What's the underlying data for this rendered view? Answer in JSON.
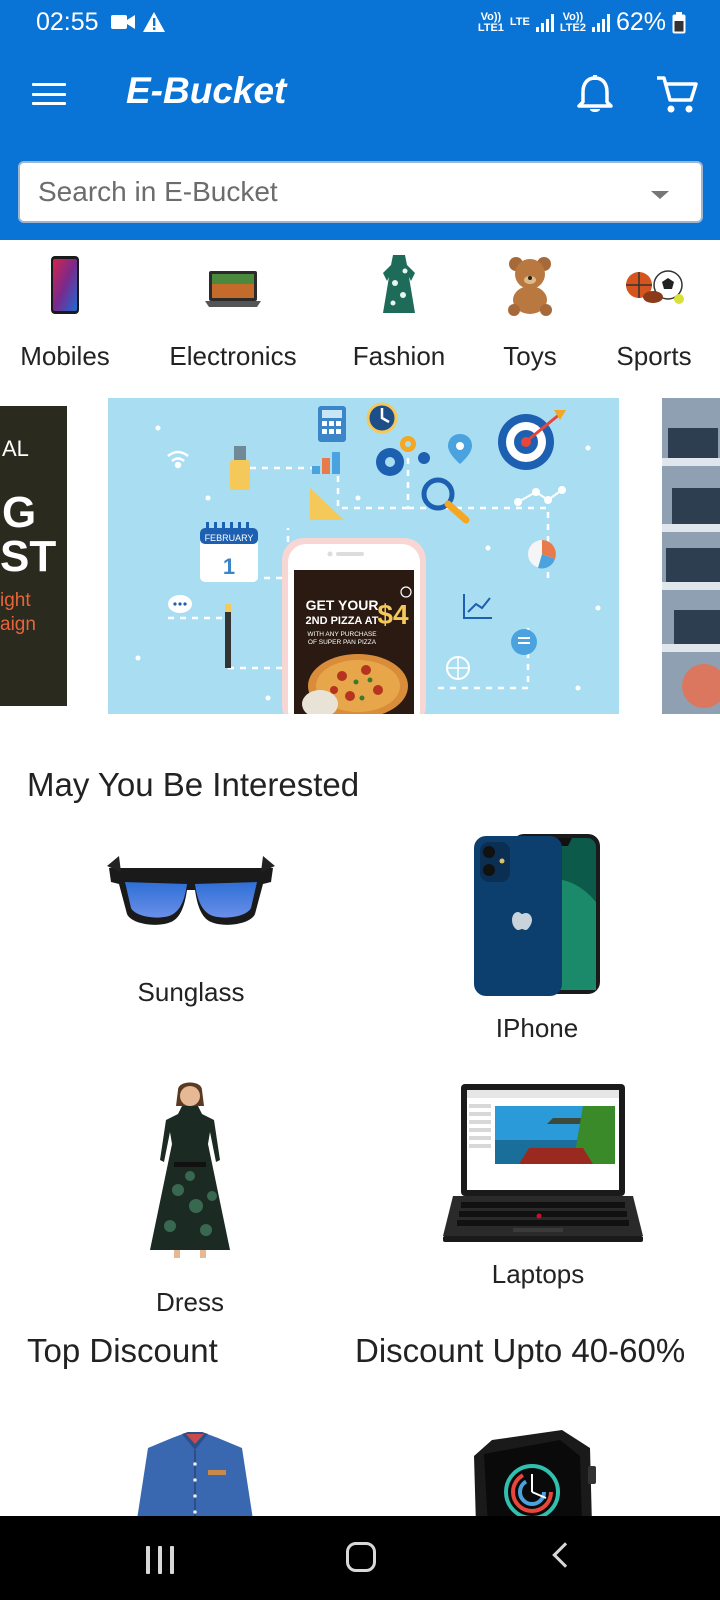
{
  "status_bar": {
    "time": "02:55",
    "battery": "62%",
    "sim1": "Vo)) LTE1",
    "sim1_data": "LTE",
    "sim2": "Vo)) LTE2"
  },
  "app_bar": {
    "title": "E-Bucket",
    "search_placeholder": "Search in E-Bucket",
    "menu_icon": "hamburger-menu-icon",
    "bell_icon": "bell-icon",
    "cart_icon": "cart-icon"
  },
  "categories": [
    {
      "label": "Mobiles",
      "icon": "mobile-phone-icon"
    },
    {
      "label": "Electronics",
      "icon": "laptop-icon"
    },
    {
      "label": "Fashion",
      "icon": "dress-icon"
    },
    {
      "label": "Toys",
      "icon": "teddy-bear-icon"
    },
    {
      "label": "Sports",
      "icon": "sports-balls-icon"
    }
  ],
  "banners": {
    "left_partial_text": [
      "AL",
      "G",
      "ST",
      "ight",
      "aign"
    ],
    "main_ad": {
      "calendar_month": "FEBRUARY",
      "calendar_day": "1",
      "ad_line1": "GET YOUR",
      "ad_line2": "2ND PIZZA AT",
      "ad_price": "$4",
      "ad_line3": "WITH ANY PURCHASE",
      "ad_line4": "OF SUPER PAN PIZZA"
    }
  },
  "interested": {
    "title": "May You Be Interested",
    "items": [
      {
        "label": "Sunglass"
      },
      {
        "label": "IPhone"
      },
      {
        "label": "Dress"
      },
      {
        "label": "Laptops"
      }
    ]
  },
  "discounts": {
    "top_title": "Top Discount",
    "range_title": "Discount Upto 40-60%"
  },
  "colors": {
    "primary": "#0a73d6",
    "nav_bar": "#000000"
  }
}
